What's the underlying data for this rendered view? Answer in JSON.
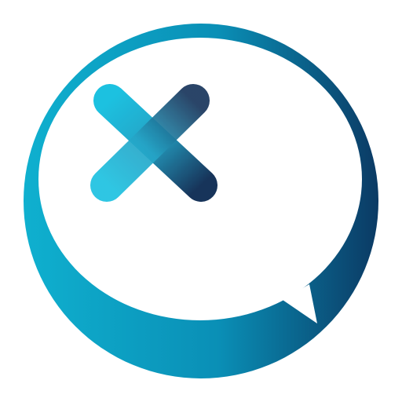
{
  "icon": {
    "name": "x-plus-speech-bubble-logo",
    "colors": {
      "teal": "#0fb3d6",
      "teal_mid": "#0a9fbf",
      "navy": "#0b2a4f",
      "navy_dark": "#061a3a",
      "background": "#ffffff"
    }
  }
}
